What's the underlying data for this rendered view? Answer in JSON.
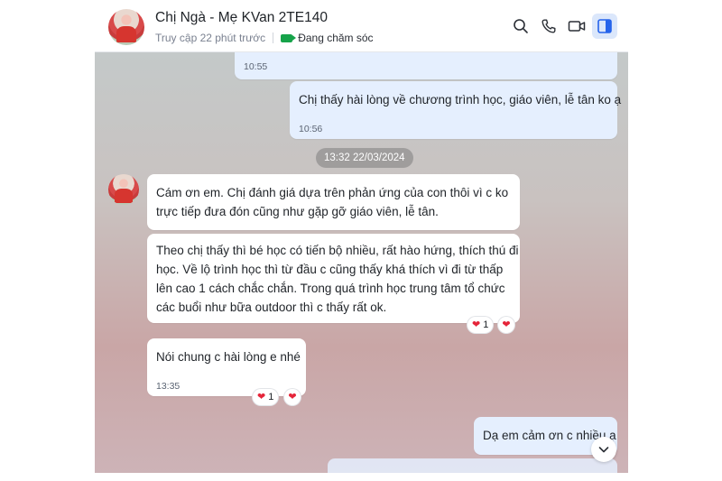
{
  "header": {
    "contact_name": "Chị Ngà - Mẹ KVan 2TE140",
    "last_seen": "Truy cập 22 phút trước",
    "status_tag": "Đang chăm sóc"
  },
  "messages": [
    {
      "direction": "outgoing",
      "text": "",
      "time": "10:55"
    },
    {
      "direction": "outgoing",
      "text": "Chị thấy hài lòng về chương trình học, giáo viên, lễ tân ko ạ",
      "time": "10:56"
    },
    {
      "direction": "incoming",
      "lines": [
        "Cám ơn em. Chị đánh giá dựa trên phản ứng của con thôi vì c ko",
        "trực tiếp đưa đón cũng như gặp gỡ giáo viên, lễ tân."
      ]
    },
    {
      "direction": "incoming",
      "lines": [
        "Theo chị thấy thì bé học có tiến bộ nhiều, rất hào hứng, thích thú đi",
        "học. Về lộ trình học thì từ đầu c cũng thấy khá thích vì đi từ thấp",
        "lên cao 1 cách chắc chắn. Trong quá trình học trung tâm tổ chức",
        "các buổi như bữa outdoor thì c thấy rất ok."
      ],
      "reaction_count": "1"
    },
    {
      "direction": "incoming",
      "text": "Nói chung c hài lòng e nhé",
      "time": "13:35",
      "reaction_count": "1"
    },
    {
      "direction": "outgoing",
      "text": "Dạ em cảm ơn c nhiều ạ"
    }
  ],
  "date_stamp": "13:32 22/03/2024",
  "icons": {
    "search": "search-icon",
    "call": "phone-icon",
    "video": "video-icon",
    "panel": "side-panel-icon",
    "reaction": "heart-icon",
    "scroll": "chevron-down-icon"
  },
  "colors": {
    "outgoing_bubble": "#e5effe",
    "incoming_bubble": "#ffffff",
    "status_tag": "#16a34a",
    "accent": "#2563eb",
    "reaction": "#e5253a"
  }
}
